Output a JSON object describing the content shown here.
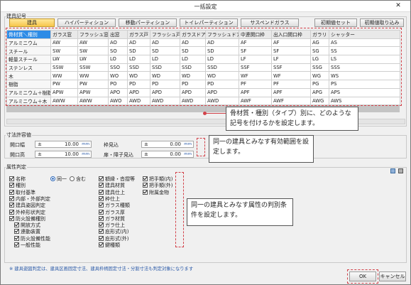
{
  "window": {
    "title": "一括設定",
    "close_glyph": "✕"
  },
  "fittings": {
    "group_label": "建具記号",
    "tabs": [
      {
        "label": "建具"
      },
      {
        "label": "ハイパーティション"
      },
      {
        "label": "移動パーティション"
      },
      {
        "label": "トイレパーティション"
      },
      {
        "label": "サスペンドガラス"
      }
    ],
    "buttons": {
      "initial_set": "初期値セット",
      "initial_load": "初期値取り込み"
    },
    "columns": [
      "骨材質＼種別",
      "ガラス窓",
      "フラッシュ窓",
      "出窓",
      "ガラス戸",
      "フラッシュ戸",
      "ガラスドア",
      "フラッシュドア",
      "中連開口枠",
      "出入口開口枠",
      "ガラリ",
      "シャッター"
    ],
    "rows": [
      [
        "アルミニウム",
        "AW",
        "AW",
        "AO",
        "AD",
        "AD",
        "AD",
        "AD",
        "AF",
        "AF",
        "AG",
        "AS"
      ],
      [
        "スチール",
        "SW",
        "SW",
        "SO",
        "SD",
        "SD",
        "SD",
        "SD",
        "SF",
        "SF",
        "SG",
        "SS"
      ],
      [
        "軽量スチール",
        "LW",
        "LW",
        "LO",
        "LD",
        "LD",
        "LD",
        "LD",
        "LF",
        "LF",
        "LG",
        "LS"
      ],
      [
        "ステンレス",
        "SSW",
        "SSW",
        "SSO",
        "SSD",
        "SSD",
        "SSD",
        "SSD",
        "SSF",
        "SSF",
        "SSG",
        "SSS"
      ],
      [
        "木",
        "WW",
        "WW",
        "WO",
        "WD",
        "WD",
        "WD",
        "WD",
        "WF",
        "WF",
        "WG",
        "WS"
      ],
      [
        "樹脂",
        "PW",
        "PW",
        "PO",
        "PD",
        "PD",
        "PD",
        "PD",
        "PF",
        "PF",
        "PG",
        "PS"
      ],
      [
        "アルミニウム＋樹脂",
        "APW",
        "APW",
        "APO",
        "APD",
        "APD",
        "APD",
        "APD",
        "APF",
        "APF",
        "APG",
        "APS"
      ],
      [
        "アルミニウム＋木",
        "AWW",
        "AWW",
        "AWO",
        "AWD",
        "AWD",
        "AWD",
        "AWD",
        "AWF",
        "AWF",
        "AWG",
        "AWS"
      ]
    ]
  },
  "tolerance": {
    "group_label": "寸法許容値",
    "fields": [
      {
        "label": "開口幅",
        "sign": "±",
        "value": "10.00",
        "unit": "mm"
      },
      {
        "label": "開口高",
        "sign": "±",
        "value": "10.00",
        "unit": "mm"
      },
      {
        "label": "枠見込",
        "sign": "±",
        "value": "0.00",
        "unit": "mm"
      },
      {
        "label": "扉・障子見込",
        "sign": "±",
        "value": "0.00",
        "unit": "mm"
      }
    ]
  },
  "attributes": {
    "group_label": "属性判定",
    "radio": {
      "same": "同一",
      "include": "含む"
    },
    "col1": [
      {
        "label": "名称",
        "checked": true
      },
      {
        "label": "種別",
        "checked": true
      },
      {
        "label": "取付基準",
        "checked": true
      },
      {
        "label": "内部・外部判定",
        "checked": true
      },
      {
        "label": "建具姿図判定",
        "checked": true
      },
      {
        "label": "外枠形状判定",
        "checked": true
      },
      {
        "label": "防火設備種別",
        "checked": true
      },
      {
        "label": "開放方式",
        "checked": true
      },
      {
        "label": "連動装置",
        "checked": true
      },
      {
        "label": "防火設備性能",
        "checked": true
      },
      {
        "label": "一般性能",
        "checked": true
      }
    ],
    "col2": [
      {
        "label": "額縁・沓摺等",
        "checked": true
      },
      {
        "label": "建具材質",
        "checked": true
      },
      {
        "label": "建具仕上",
        "checked": true
      },
      {
        "label": "枠仕上",
        "checked": true
      },
      {
        "label": "ガラス種類",
        "checked": true
      },
      {
        "label": "ガラス厚",
        "checked": true
      },
      {
        "label": "ガラ材質",
        "checked": true
      },
      {
        "label": "ガラ仕上",
        "checked": true
      },
      {
        "label": "庇形式(内)",
        "checked": true
      },
      {
        "label": "庇形式(外)",
        "checked": true
      },
      {
        "label": "鍵種類",
        "checked": true
      }
    ],
    "col3": [
      {
        "label": "把手類(内)",
        "checked": true
      },
      {
        "label": "把手類(外)",
        "checked": true
      },
      {
        "label": "附属金物",
        "checked": true
      }
    ]
  },
  "callouts": {
    "c1": "骨材質・種別（タイプ）別に、どのような記号を付けるかを設定します。",
    "c2": "同一の建具とみなす有効範囲を設定します。",
    "c3": "同一の建具とみなす属性の判別条件を設定します。"
  },
  "footnote": "※ 建具姿図判定は、建具区画固定寸法、建具枠柄固定寸法・分割寸法も判定対象になります",
  "actions": {
    "ok": "OK",
    "cancel": "キャンセル"
  },
  "colors": {
    "active_tab": "#f7c64a",
    "header_select": "#2d8be6",
    "highlight": "#d2424a"
  }
}
